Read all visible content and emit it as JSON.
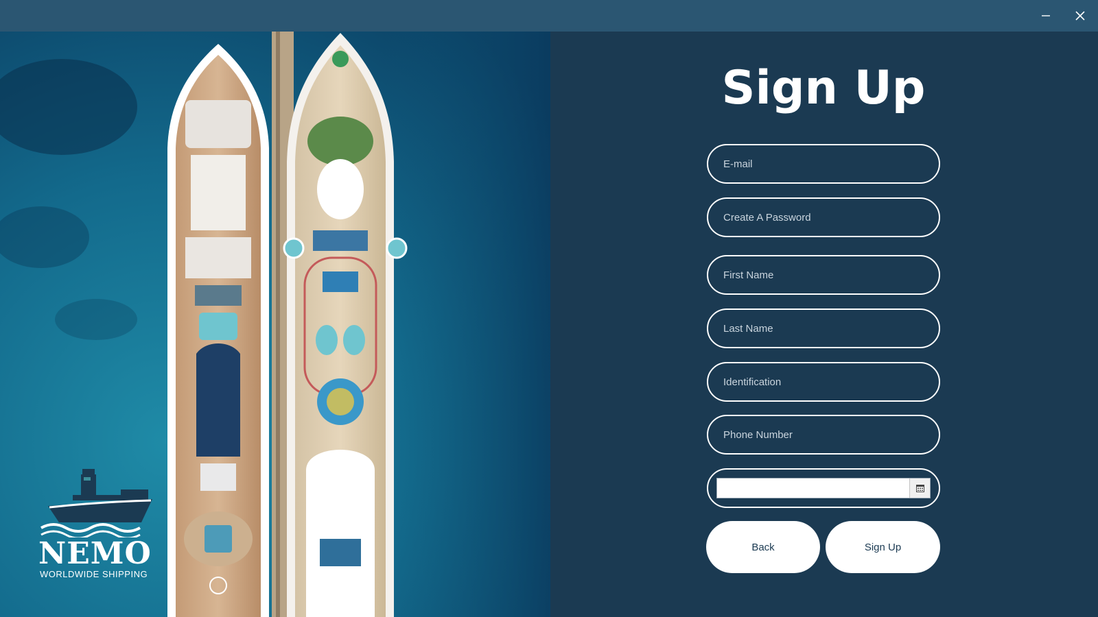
{
  "window": {
    "minimize_icon": "minimize-icon",
    "close_icon": "close-icon"
  },
  "hero": {
    "description": "",
    "logo": {
      "name": "NEMO",
      "tagline": "WORLDWIDE SHIPPING"
    }
  },
  "form": {
    "title": "Sign Up",
    "fields": {
      "email": {
        "placeholder": "E-mail",
        "value": ""
      },
      "password": {
        "placeholder": "Create A Password",
        "value": ""
      },
      "first_name": {
        "placeholder": "First Name",
        "value": ""
      },
      "last_name": {
        "placeholder": "Last Name",
        "value": ""
      },
      "identification": {
        "placeholder": "Identification",
        "value": ""
      },
      "phone": {
        "placeholder": "Phone Number",
        "value": ""
      },
      "birth_date": {
        "value": "",
        "picker_icon": "calendar-icon"
      }
    },
    "buttons": {
      "back": "Back",
      "sign_up": "Sign Up"
    }
  },
  "colors": {
    "panel_bg": "#1b3a52",
    "titlebar_bg": "#2b5672",
    "button_bg": "#ffffff"
  }
}
